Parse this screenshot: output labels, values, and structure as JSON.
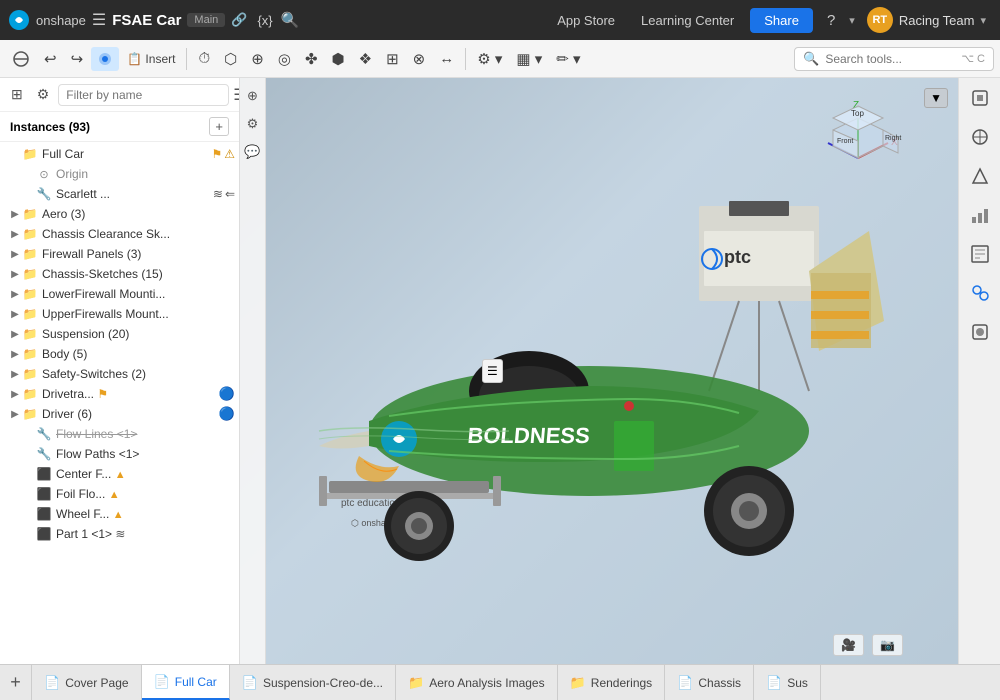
{
  "header": {
    "logo_text": "onshape",
    "hamburger": "☰",
    "doc_title": "FSAE Car",
    "branch": "Main",
    "link_icon": "🔗",
    "variable_icon": "{x}",
    "search_icon": "🔍",
    "app_store": "App Store",
    "learning_center": "Learning Center",
    "share": "Share",
    "help": "?",
    "team": "Racing Team",
    "team_initials": "RT",
    "chevron_down": "▾"
  },
  "toolbar": {
    "undo": "↩",
    "redo": "↪",
    "t1": "⊙",
    "t2": "📋",
    "t3": "⏱",
    "t4": "⬡",
    "t5": "⊕",
    "t6": "◎",
    "t7": "✤",
    "t8": "⬢",
    "t9": "❖",
    "t10": "⊞",
    "t11": "⊗",
    "t12": "↔",
    "t13": "⊕",
    "t14": "⚙",
    "t15": "▦",
    "t16": "✏",
    "search_placeholder": "Search tools...",
    "search_shortcut": "⌥ C"
  },
  "sidebar": {
    "filter_placeholder": "Filter by name",
    "instances_label": "Instances (93)",
    "items": [
      {
        "id": "full-car",
        "indent": 2,
        "chevron": "",
        "icon": "📁",
        "label": "Full Car",
        "extra": "⚑ ⚠",
        "depth": 1
      },
      {
        "id": "origin",
        "indent": 4,
        "chevron": "",
        "icon": "⊙",
        "label": "Origin",
        "extra": "",
        "depth": 2,
        "muted": true
      },
      {
        "id": "scarlett",
        "indent": 4,
        "chevron": "",
        "icon": "👤",
        "label": "Scarlett ...",
        "extra": "≋ ⇐",
        "depth": 2
      },
      {
        "id": "aero",
        "indent": 2,
        "chevron": "▶",
        "icon": "📁",
        "label": "Aero (3)",
        "extra": "",
        "depth": 1
      },
      {
        "id": "chassis-clearance",
        "indent": 2,
        "chevron": "▶",
        "icon": "📁",
        "label": "Chassis Clearance Sk...",
        "extra": "",
        "depth": 1
      },
      {
        "id": "firewall-panels",
        "indent": 2,
        "chevron": "▶",
        "icon": "📁",
        "label": "Firewall Panels (3)",
        "extra": "",
        "depth": 1
      },
      {
        "id": "chassis-sketches",
        "indent": 2,
        "chevron": "▶",
        "icon": "📁",
        "label": "Chassis-Sketches (15)",
        "extra": "",
        "depth": 1
      },
      {
        "id": "lower-firewall",
        "indent": 2,
        "chevron": "▶",
        "icon": "📁",
        "label": "LowerFirewall Mounti...",
        "extra": "",
        "depth": 1
      },
      {
        "id": "upper-firewalls",
        "indent": 2,
        "chevron": "▶",
        "icon": "📁",
        "label": "UpperFirewalls Mount...",
        "extra": "",
        "depth": 1
      },
      {
        "id": "suspension",
        "indent": 2,
        "chevron": "▶",
        "icon": "📁",
        "label": "Suspension (20)",
        "extra": "",
        "depth": 1
      },
      {
        "id": "body",
        "indent": 2,
        "chevron": "▶",
        "icon": "📁",
        "label": "Body (5)",
        "extra": "",
        "depth": 1
      },
      {
        "id": "safety-switches",
        "indent": 2,
        "chevron": "▶",
        "icon": "📁",
        "label": "Safety-Switches (2)",
        "extra": "",
        "depth": 1
      },
      {
        "id": "drivetrain",
        "indent": 2,
        "chevron": "▶",
        "icon": "📁",
        "label": "Drivetra... ⚑",
        "extra": "🔵",
        "depth": 1
      },
      {
        "id": "driver",
        "indent": 2,
        "chevron": "▶",
        "icon": "📁",
        "label": "Driver (6)",
        "extra": "🔵",
        "depth": 1
      },
      {
        "id": "flow-lines",
        "indent": 4,
        "chevron": "",
        "icon": "👤",
        "label": "Flow Lines <1>",
        "extra": "",
        "depth": 2,
        "strikethrough": true
      },
      {
        "id": "flow-paths",
        "indent": 4,
        "chevron": "",
        "icon": "👤",
        "label": "Flow Paths <1>",
        "extra": "",
        "depth": 2
      },
      {
        "id": "center-f",
        "indent": 4,
        "chevron": "",
        "icon": "⊞",
        "label": "Center F... ▲",
        "extra": "",
        "depth": 2
      },
      {
        "id": "foil-flo",
        "indent": 4,
        "chevron": "",
        "icon": "⊞",
        "label": "Foil Flo... ▲",
        "extra": "",
        "depth": 2
      },
      {
        "id": "wheel-f",
        "indent": 4,
        "chevron": "",
        "icon": "⊞",
        "label": "Wheel F... ▲",
        "extra": "",
        "depth": 2
      },
      {
        "id": "part1",
        "indent": 4,
        "chevron": "",
        "icon": "⊞",
        "label": "Part 1 <1> ≋",
        "extra": "",
        "depth": 2
      }
    ]
  },
  "bottom_tabs": [
    {
      "id": "cover-page",
      "icon": "📄",
      "label": "Cover Page",
      "active": false
    },
    {
      "id": "full-car",
      "icon": "📄",
      "label": "Full Car",
      "active": true
    },
    {
      "id": "suspension-creo",
      "icon": "📄",
      "label": "Suspension-Creo-de...",
      "active": false
    },
    {
      "id": "aero-analysis",
      "icon": "📁",
      "label": "Aero Analysis Images",
      "active": false
    },
    {
      "id": "renderings",
      "icon": "📁",
      "label": "Renderings",
      "active": false
    },
    {
      "id": "chassis",
      "icon": "📄",
      "label": "Chassis",
      "active": false
    },
    {
      "id": "sus",
      "icon": "📄",
      "label": "Sus",
      "active": false
    }
  ],
  "viewport": {
    "bg_color": "#b8c8d8"
  },
  "nav_cube": {
    "top": "Top",
    "front": "Front",
    "right": "Right"
  }
}
